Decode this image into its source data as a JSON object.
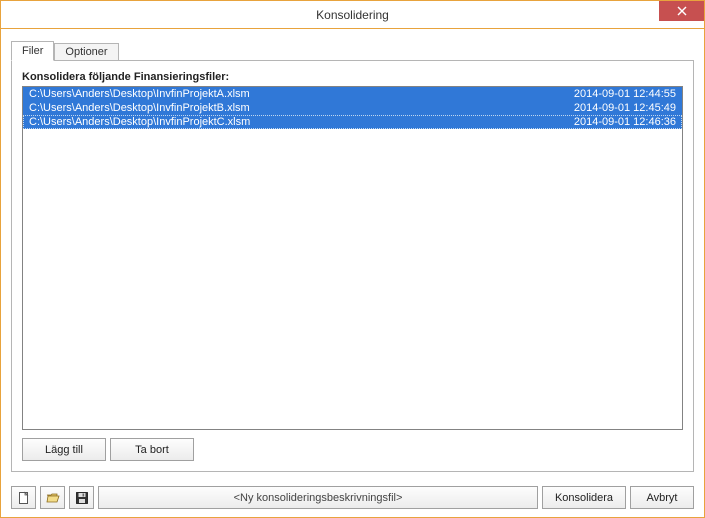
{
  "window": {
    "title": "Konsolidering"
  },
  "tabs": {
    "filer": "Filer",
    "optioner": "Optioner"
  },
  "panel": {
    "list_label": "Konsolidera följande Finansieringsfiler:"
  },
  "files": [
    {
      "path": "C:\\Users\\Anders\\Desktop\\InvfinProjektA.xlsm",
      "timestamp": "2014-09-01 12:44:55"
    },
    {
      "path": "C:\\Users\\Anders\\Desktop\\InvfinProjektB.xlsm",
      "timestamp": "2014-09-01 12:45:49"
    },
    {
      "path": "C:\\Users\\Anders\\Desktop\\InvfinProjektC.xlsm",
      "timestamp": "2014-09-01 12:46:36"
    }
  ],
  "buttons": {
    "add": "Lägg till",
    "remove": "Ta bort",
    "consolidate": "Konsolidera",
    "cancel": "Avbryt"
  },
  "bottom": {
    "filepath_placeholder": "<Ny konsolideringsbeskrivningsfil>"
  }
}
